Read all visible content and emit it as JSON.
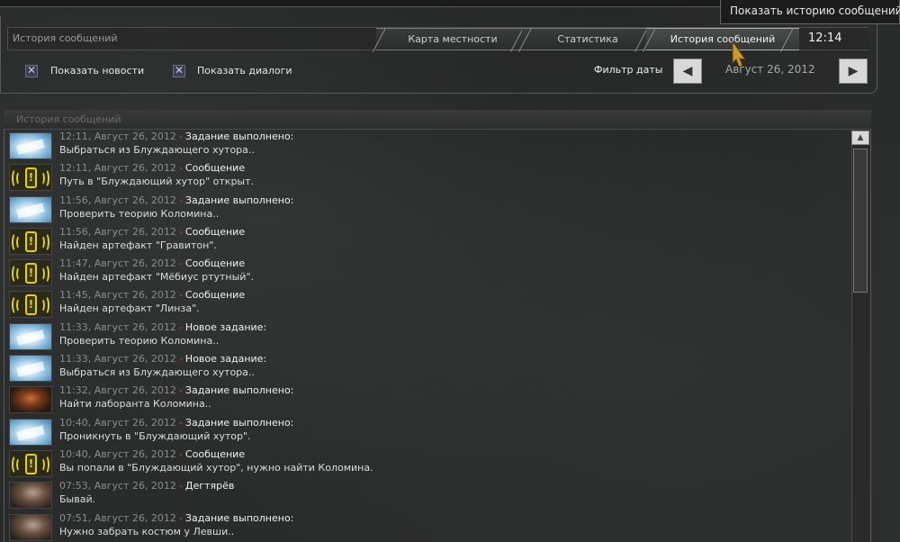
{
  "tooltip": "Показать историю сообщений",
  "header": {
    "title": "История сообщений",
    "tabs": [
      {
        "label": "Карта местности"
      },
      {
        "label": "Статистика"
      },
      {
        "label": "История сообщений"
      }
    ],
    "clock": "12:14",
    "checkboxes": [
      {
        "label": "Показать новости",
        "checked": true
      },
      {
        "label": "Показать диалоги",
        "checked": true
      }
    ],
    "filter_label": "Фильтр даты",
    "date": "Август 26, 2012",
    "prev_glyph": "◀",
    "next_glyph": "▶"
  },
  "list": {
    "title": "История сообщений",
    "messages": [
      {
        "icon": "map-icon",
        "time": "12:11, Август 26, 2012",
        "sep": "-",
        "type": "Задание выполнено:",
        "text": "Выбраться из Блуждающего хутора.."
      },
      {
        "icon": "pda-icon",
        "time": "12:11, Август 26, 2012",
        "sep": "-",
        "type": "Сообщение",
        "text": "Путь в \"Блуждающий хутор\" открыт."
      },
      {
        "icon": "map-icon",
        "time": "11:56, Август 26, 2012",
        "sep": "-",
        "type": "Задание выполнено:",
        "text": "Проверить теорию Коломина.."
      },
      {
        "icon": "pda-icon",
        "time": "11:56, Август 26, 2012",
        "sep": "-",
        "type": "Сообщение",
        "text": "Найден артефакт \"Гравитон\"."
      },
      {
        "icon": "pda-icon",
        "time": "11:47, Август 26, 2012",
        "sep": "-",
        "type": "Сообщение",
        "text": "Найден артефакт \"Мёбиус ртутный\"."
      },
      {
        "icon": "pda-icon",
        "time": "11:45, Август 26, 2012",
        "sep": "-",
        "type": "Сообщение",
        "text": "Найден артефакт \"Линза\"."
      },
      {
        "icon": "map-icon",
        "time": "11:33, Август 26, 2012",
        "sep": "-",
        "type": "Новое задание:",
        "text": "Проверить теорию Коломина.."
      },
      {
        "icon": "map-icon",
        "time": "11:33, Август 26, 2012",
        "sep": "-",
        "type": "Новое задание:",
        "text": "Выбраться из Блуждающего хутора.."
      },
      {
        "icon": "lab-portrait-icon",
        "time": "11:32, Август 26, 2012",
        "sep": "-",
        "type": "Задание выполнено:",
        "text": "Найти лаборанта Коломина.."
      },
      {
        "icon": "map-icon",
        "time": "10:40, Август 26, 2012",
        "sep": "-",
        "type": "Задание выполнено:",
        "text": "Проникнуть в \"Блуждающий хутор\"."
      },
      {
        "icon": "pda-icon",
        "time": "10:40, Август 26, 2012",
        "sep": "-",
        "type": "Сообщение",
        "text": "Вы попали в \"Блуждающий хутор\", нужно найти Коломина."
      },
      {
        "icon": "portrait-icon",
        "time": "07:53, Август 26, 2012",
        "sep": "-",
        "type": "Дегтярёв",
        "text": "Бывай."
      },
      {
        "icon": "portrait-icon",
        "time": "07:51, Август 26, 2012",
        "sep": "-",
        "type": "Задание выполнено:",
        "text": "Нужно забрать костюм у Левши.."
      }
    ]
  },
  "scrollbar": {
    "up_glyph": "▲"
  },
  "colors": {
    "background": "#2b2c2c",
    "separator": "#d05030",
    "pda_yellow": "#e8d200"
  }
}
